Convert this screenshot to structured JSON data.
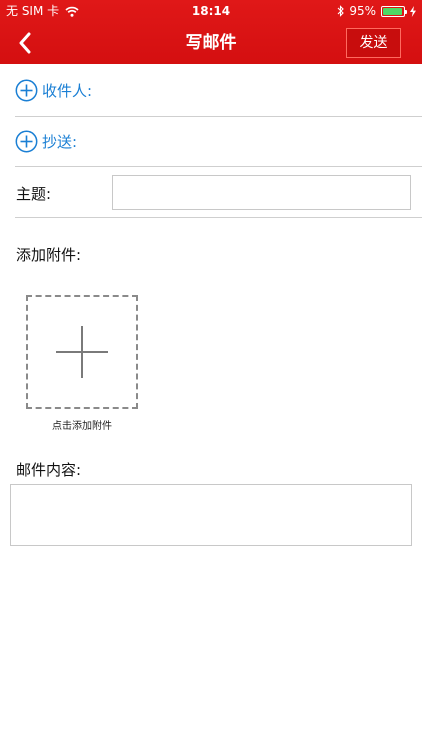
{
  "status_bar": {
    "carrier": "无 SIM 卡",
    "time": "18:14",
    "battery_percent": "95%",
    "battery_level": 0.95,
    "battery_color": "#4cd964"
  },
  "nav": {
    "title": "写邮件",
    "back_icon": "chevron-left-icon",
    "send_label": "发送"
  },
  "form": {
    "recipient_label": "收件人:",
    "cc_label": "抄送:",
    "subject_label": "主题:",
    "subject_value": "",
    "attachment_label": "添加附件:",
    "attachment_hint": "点击添加附件",
    "content_label": "邮件内容:",
    "content_value": ""
  },
  "colors": {
    "header_red": "#d40f10",
    "link_blue": "#1a7fd4",
    "divider": "#cfcfcf"
  }
}
